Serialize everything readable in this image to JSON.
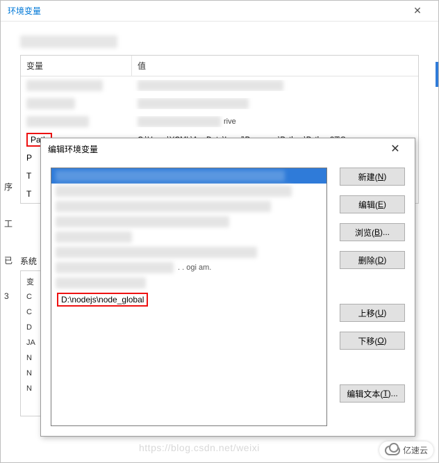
{
  "parent": {
    "title": "环境变量",
    "close_glyph": "✕",
    "headers": {
      "var": "变量",
      "val": "值"
    },
    "path_label": "Path",
    "path_value": "C:\\Users\\YCML\\AppData\\Local\\Programs\\Python\\Python37\\S...",
    "trailing_chars": [
      "P",
      "T",
      "T"
    ],
    "sysvars_label": "系统",
    "sys_rows": [
      "变",
      "C",
      "C",
      "D",
      "JA",
      "N",
      "N",
      "N"
    ]
  },
  "left_edge": [
    "序",
    "工",
    "已",
    "3"
  ],
  "edit": {
    "title": "编辑环境变量",
    "close_glyph": "✕",
    "highlighted_entry": "D:\\nodejs\\node_global",
    "buttons": {
      "new": {
        "label": "新建(",
        "key": "N",
        "suffix": ")"
      },
      "edit": {
        "label": "编辑(",
        "key": "E",
        "suffix": ")"
      },
      "browse": {
        "label": "浏览(",
        "key": "B",
        "suffix": ")..."
      },
      "delete": {
        "label": "删除(",
        "key": "D",
        "suffix": ")"
      },
      "up": {
        "label": "上移(",
        "key": "U",
        "suffix": ")"
      },
      "down": {
        "label": "下移(",
        "key": "O",
        "suffix": ")"
      },
      "edittext": {
        "label": "编辑文本(",
        "key": "T",
        "suffix": ")..."
      }
    }
  },
  "watermark": "https://blog.csdn.net/weixi",
  "logo_text": "亿速云"
}
